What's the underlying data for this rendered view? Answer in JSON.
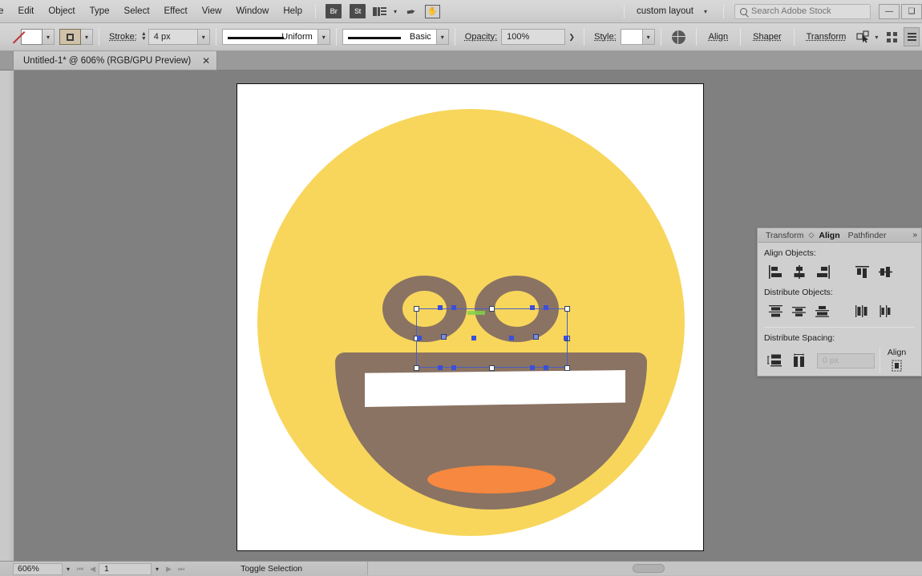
{
  "menubar": {
    "items": [
      "File",
      "Edit",
      "Object",
      "Type",
      "Select",
      "Effect",
      "View",
      "Window",
      "Help"
    ],
    "bridge_badge": "Br",
    "stock_badge": "St",
    "layout_label": "custom layout",
    "search_placeholder": "Search Adobe Stock",
    "minimize": "—",
    "maximize": "❑"
  },
  "controlbar": {
    "fill_swatch": "none",
    "stroke_swatch": "stroke",
    "stroke_label": "Stroke:",
    "stroke_weight": "4 px",
    "profile_label": "Uniform",
    "brush_label": "Basic",
    "opacity_label": "Opacity:",
    "opacity_value": "100%",
    "style_label": "Style:",
    "align_label": "Align",
    "shaper_label": "Shaper",
    "transform_label": "Transform",
    "dropdown_caret": "⌄"
  },
  "tabbar": {
    "document_title": "Untitled-1* @ 606% (RGB/GPU Preview)",
    "close_glyph": "✕"
  },
  "canvas": {
    "face_color": "#f8d65c",
    "feature_color": "#8a7362",
    "tongue_color": "#f7883f",
    "teeth_color": "#ffffff",
    "artboard_bg": "#ffffff",
    "workspace_bg": "#808080",
    "selection_color": "#3b4fd8",
    "smart_guide_color": "#7fd44a"
  },
  "align_panel": {
    "tabs": [
      {
        "label": "Transform",
        "active": false
      },
      {
        "label": "Align",
        "active": true
      },
      {
        "label": "Pathfinder",
        "active": false
      }
    ],
    "more_glyph": "»",
    "align_objects_label": "Align Objects:",
    "distribute_objects_label": "Distribute Objects:",
    "distribute_spacing_label": "Distribute Spacing:",
    "spacing_value": "0 px",
    "align_to_label": "Align"
  },
  "statusbar": {
    "zoom_level": "606%",
    "page_number": "1",
    "tool_status": "Toggle Selection",
    "first_glyph": "⏮",
    "prev_glyph": "◀",
    "next_glyph": "▶",
    "last_glyph": "⏭",
    "play_glyph": "▶",
    "less_glyph": "‹"
  }
}
